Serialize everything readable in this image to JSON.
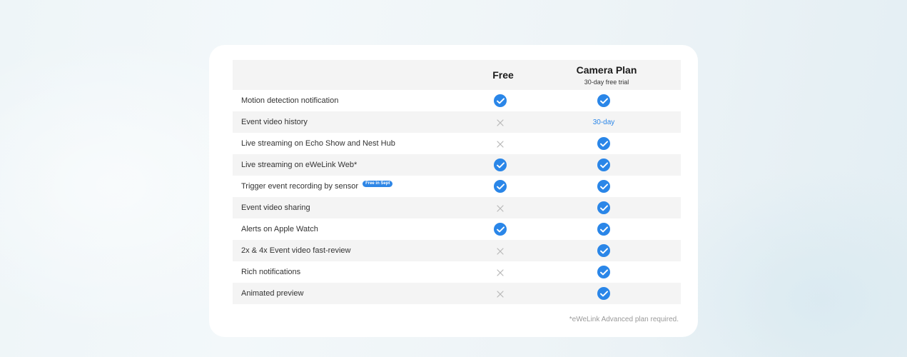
{
  "columns": {
    "free": "Free",
    "plan": "Camera Plan",
    "plan_sub": "30-day free trial"
  },
  "rows": [
    {
      "feature": "Motion detection notification",
      "free": "check",
      "plan": "check"
    },
    {
      "feature": "Event video history",
      "free": "cross",
      "plan": "30-day"
    },
    {
      "feature": "Live streaming on Echo Show and Nest Hub",
      "free": "cross",
      "plan": "check"
    },
    {
      "feature": "Live streaming on eWeLink Web*",
      "free": "check",
      "plan": "check"
    },
    {
      "feature": "Trigger event recording by sensor",
      "badge": "Free in Sept",
      "free": "check",
      "plan": "check"
    },
    {
      "feature": "Event video sharing",
      "free": "cross",
      "plan": "check"
    },
    {
      "feature": "Alerts on Apple Watch",
      "free": "check",
      "plan": "check"
    },
    {
      "feature": "2x & 4x Event video fast-review",
      "free": "cross",
      "plan": "check"
    },
    {
      "feature": "Rich notifications",
      "free": "cross",
      "plan": "check"
    },
    {
      "feature": "Animated preview",
      "free": "cross",
      "plan": "check"
    }
  ],
  "footnote": "*eWeLink Advanced plan required.",
  "icons": {
    "check": "check-circle-icon",
    "cross": "cross-icon"
  },
  "colors": {
    "accent": "#2a86e8",
    "cross": "#b8b8b8",
    "row_shade": "#f4f4f4"
  }
}
